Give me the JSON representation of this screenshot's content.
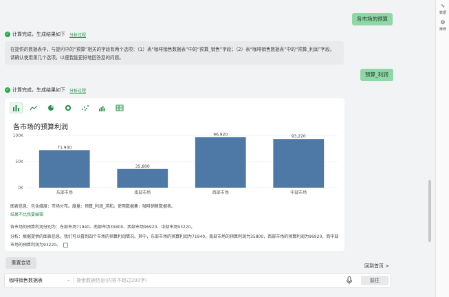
{
  "rail": {
    "items": [
      {
        "label": "数据",
        "icon": "pulse-icon"
      },
      {
        "label": "推荐",
        "icon": "gear-icon"
      }
    ]
  },
  "conversation": {
    "user_msg_1": "各市场的预算",
    "status_text": "计算完成，生成结果如下",
    "analysis_link": "分析过程",
    "clarify_text": "在提供的数据表中，与提问中的“预算”相关的字段有两个选项：（1）表“咖啡销售数据表”中的“预算_销售”字段；（2）表“咖啡销售数据表”中的“预算_利润”字段。请确认使用第几个选项，以便我能更好地回答您的问题。",
    "user_msg_2": "预算_利润",
    "status_text_2": "计算完成，生成结果如下",
    "analysis_link_2": "分析过程"
  },
  "chart_card": {
    "chart_types": [
      "bar-chart-icon",
      "line-chart-icon",
      "pie-chart-icon",
      "donut-chart-icon",
      "scatter-chart-icon",
      "area-chart-icon",
      "table-icon"
    ],
    "chart_info": "图表信息：包含维度：市场分布。度量：预算_利润_求和。使用数据集：咖啡销售数据表。",
    "feedback_link": "结果不比我要编辑",
    "summary": "各市场的预算利润分别为：东部市场71940、南部市场35800、西部市场96920、中部市场93220。",
    "analysis": "分析：根据提供的图表信息，我们可以看到四个市场的预算利润情况。其中，东部市场的预算利润为71940，南部市场的预算利润为35800，西部市场的预算利润为96920，而中部市场的预算利润为93220。"
  },
  "chart_data": {
    "type": "bar",
    "title": "各市场的预算利润",
    "categories": [
      "东部市场",
      "南部市场",
      "西部市场",
      "中部市场"
    ],
    "values": [
      71940,
      35800,
      96920,
      93220
    ],
    "value_labels": [
      "71,940",
      "35,800",
      "96,920",
      "93,220"
    ],
    "ylim": [
      0,
      100000
    ],
    "yticks": [
      0,
      50000,
      100000
    ],
    "ytick_labels": [
      "0K",
      "50K",
      "100K"
    ],
    "bar_color": "#4e79a7",
    "grid": true
  },
  "footer": {
    "reset_label": "重置会话",
    "back_home_label": "回到首页 >",
    "dataset_value": "咖啡销售数据表",
    "query_placeholder": "搜索数据信息(内容不超过200字)",
    "go_label": "前往"
  },
  "colors": {
    "accent": "#2a8f4c",
    "user_bubble": "#8fd7a6"
  }
}
